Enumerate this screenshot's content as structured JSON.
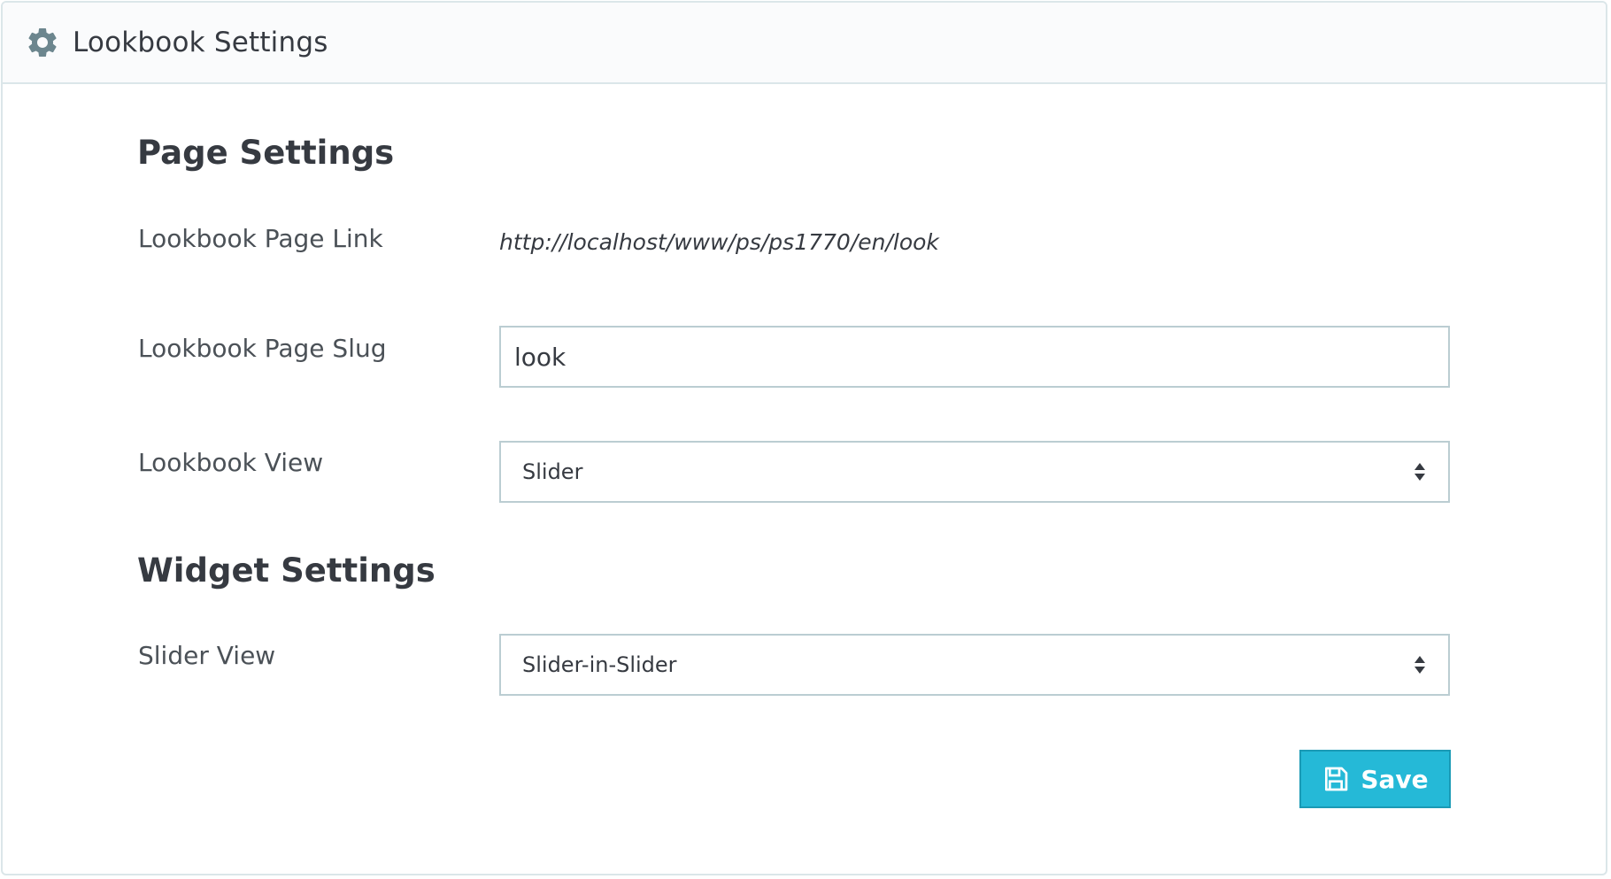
{
  "header": {
    "title": "Lookbook Settings",
    "icon": "gear-icon"
  },
  "page_settings": {
    "title": "Page Settings",
    "link_label": "Lookbook Page Link",
    "link_value": "http://localhost/www/ps/ps1770/en/look",
    "slug_label": "Lookbook Page Slug",
    "slug_value": "look",
    "view_label": "Lookbook View",
    "view_value": "Slider"
  },
  "widget_settings": {
    "title": "Widget Settings",
    "slider_view_label": "Slider View",
    "slider_view_value": "Slider-in-Slider"
  },
  "actions": {
    "save_label": "Save",
    "save_icon": "floppy-disk-icon"
  },
  "colors": {
    "accent": "#25b9d7",
    "text": "#363a41",
    "border": "#bbcdd2"
  }
}
